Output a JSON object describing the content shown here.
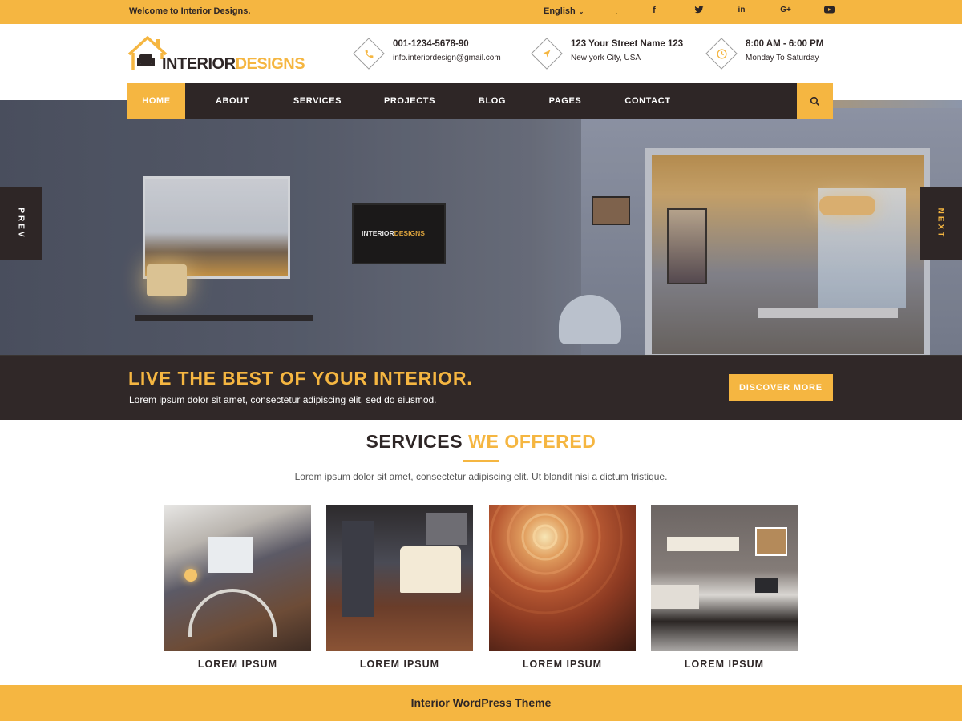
{
  "topbar": {
    "welcome": "Welcome to Interior Designs.",
    "language": "English",
    "social": [
      {
        "icon": "facebook-icon",
        "glyph": "f"
      },
      {
        "icon": "twitter-icon",
        "glyph": "t"
      },
      {
        "icon": "linkedin-icon",
        "glyph": "in"
      },
      {
        "icon": "google-plus-icon",
        "glyph": "G+"
      },
      {
        "icon": "youtube-icon",
        "glyph": "▶"
      }
    ]
  },
  "logo": {
    "part1": "INTERIOR",
    "part2": "DESIGNS"
  },
  "contact": {
    "phone": "001-1234-5678-90",
    "email": "info.interiordesign@gmail.com",
    "address_line1": "123 Your Street Name 123",
    "address_line2": "New york City, USA",
    "hours": "8:00 AM - 6:00 PM",
    "days": "Monday To Saturday"
  },
  "nav": {
    "items": [
      "HOME",
      "ABOUT",
      "SERVICES",
      "PROJECTS",
      "BLOG",
      "PAGES",
      "CONTACT"
    ],
    "active_index": 0
  },
  "hero": {
    "prev_label": "PREV",
    "next_label": "NEXT",
    "tv_logo_part1": "INTERIOR",
    "tv_logo_part2": "DESIGNS",
    "title": "LIVE THE BEST OF YOUR INTERIOR.",
    "subtitle": "Lorem ipsum dolor sit amet, consectetur adipiscing elit, sed do eiusmod.",
    "button": "DISCOVER MORE"
  },
  "services": {
    "title_part1": "SERVICES",
    "title_part2": "WE OFFERED",
    "subtitle": "Lorem ipsum dolor sit amet, consectetur adipiscing elit. Ut blandit nisi a dictum tristique.",
    "cards": [
      {
        "label": "LOREM IPSUM"
      },
      {
        "label": "LOREM IPSUM"
      },
      {
        "label": "LOREM IPSUM"
      },
      {
        "label": "LOREM IPSUM"
      }
    ]
  },
  "footer": {
    "text": "Interior WordPress Theme"
  },
  "colors": {
    "accent": "#f5b641",
    "dark": "#2e2626",
    "white": "#ffffff"
  }
}
